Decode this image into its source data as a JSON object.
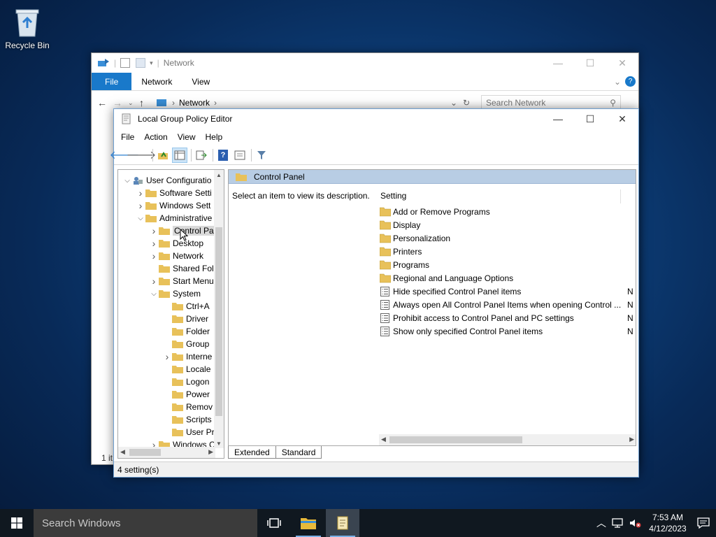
{
  "desktop": {
    "recycle_bin_label": "Recycle Bin"
  },
  "explorer": {
    "title": "Network",
    "ribbon_tabs": [
      "File",
      "Network",
      "View"
    ],
    "address_root": "Network",
    "search_placeholder": "Search Network",
    "status_fragment": "1 it"
  },
  "gpe": {
    "title": "Local Group Policy Editor",
    "menu": [
      "File",
      "Action",
      "View",
      "Help"
    ],
    "tree": [
      {
        "label": "User Configuratio",
        "expand": "down"
      },
      {
        "label": "Software Setti",
        "expand": "right"
      },
      {
        "label": "Windows Sett",
        "expand": "right"
      },
      {
        "label": "Administrative",
        "expand": "down"
      },
      {
        "label": "Control Pa",
        "expand": "right",
        "selected": true
      },
      {
        "label": "Desktop",
        "expand": "right"
      },
      {
        "label": "Network",
        "expand": "right"
      },
      {
        "label": "Shared Fol",
        "expand": ""
      },
      {
        "label": "Start Menu",
        "expand": "right"
      },
      {
        "label": "System",
        "expand": "down"
      },
      {
        "label": "Ctrl+A",
        "expand": ""
      },
      {
        "label": "Driver",
        "expand": ""
      },
      {
        "label": "Folder",
        "expand": ""
      },
      {
        "label": "Group",
        "expand": ""
      },
      {
        "label": "Interne",
        "expand": "right"
      },
      {
        "label": "Locale",
        "expand": ""
      },
      {
        "label": "Logon",
        "expand": ""
      },
      {
        "label": "Power",
        "expand": ""
      },
      {
        "label": "Remov",
        "expand": ""
      },
      {
        "label": "Scripts",
        "expand": ""
      },
      {
        "label": "User Pr",
        "expand": ""
      },
      {
        "label": "Windows C",
        "expand": "right"
      }
    ],
    "panel_header": "Control Panel",
    "description": "Select an item to view its description.",
    "column_setting": "Setting",
    "items": [
      {
        "label": "Add or Remove Programs",
        "type": "folder",
        "state": ""
      },
      {
        "label": "Display",
        "type": "folder",
        "state": ""
      },
      {
        "label": "Personalization",
        "type": "folder",
        "state": ""
      },
      {
        "label": "Printers",
        "type": "folder",
        "state": ""
      },
      {
        "label": "Programs",
        "type": "folder",
        "state": ""
      },
      {
        "label": "Regional and Language Options",
        "type": "folder",
        "state": ""
      },
      {
        "label": "Hide specified Control Panel items",
        "type": "policy",
        "state": "N"
      },
      {
        "label": "Always open All Control Panel Items when opening Control ...",
        "type": "policy",
        "state": "N"
      },
      {
        "label": "Prohibit access to Control Panel and PC settings",
        "type": "policy",
        "state": "N"
      },
      {
        "label": "Show only specified Control Panel items",
        "type": "policy",
        "state": "N"
      }
    ],
    "tabs": [
      "Extended",
      "Standard"
    ],
    "status": "4 setting(s)"
  },
  "taskbar": {
    "search_placeholder": "Search Windows",
    "time": "7:53 AM",
    "date": "4/12/2023"
  },
  "colors": {
    "accent": "#1979ca",
    "folder": "#e8c15a",
    "header": "#b8cde4"
  }
}
